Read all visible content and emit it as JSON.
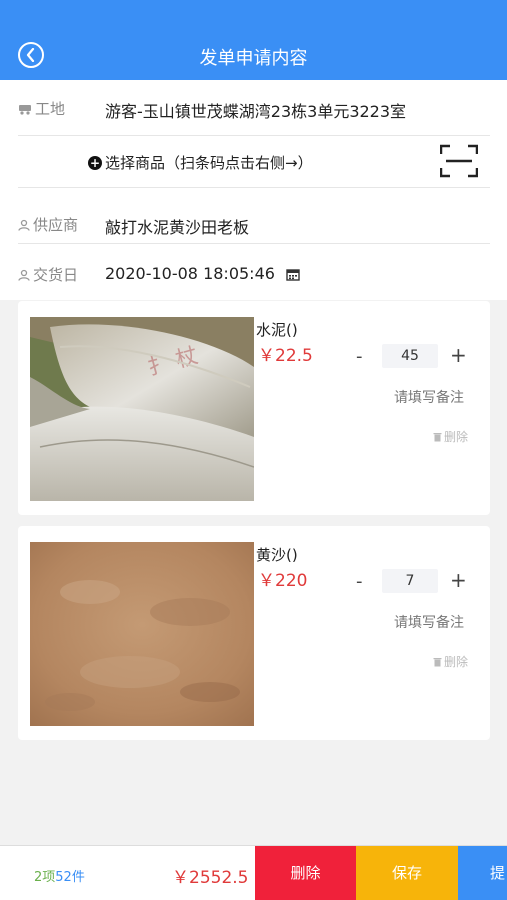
{
  "header": {
    "title": "发单申请内容"
  },
  "form": {
    "site_label": "工地",
    "site_value": "游客-玉山镇世茂蝶湖湾23栋3单元3223室",
    "select_label": "选择商品（扫条码点击右侧→）",
    "supplier_label": "供应商",
    "supplier_value": "敲打水泥黄沙田老板",
    "delivery_label": "交货日",
    "delivery_value": "2020-10-08 18:05:46"
  },
  "items": [
    {
      "name": "水泥()",
      "price": "￥22.5",
      "qty": "45",
      "minus": "-",
      "plus": "+",
      "note": "请填写备注",
      "delete": "删除"
    },
    {
      "name": "黄沙()",
      "price": "￥220",
      "qty": "7",
      "minus": "-",
      "plus": "+",
      "note": "请填写备注",
      "delete": "删除"
    }
  ],
  "footer": {
    "count_items": "2项",
    "count_pieces": "52件",
    "total": "￥2552.5",
    "delete_label": "删除",
    "save_label": "保存",
    "submit_label": "提交"
  },
  "colors": {
    "primary": "#3a8ff5",
    "price": "#e03a3a",
    "delete": "#f0213a",
    "save": "#f7b40a"
  }
}
